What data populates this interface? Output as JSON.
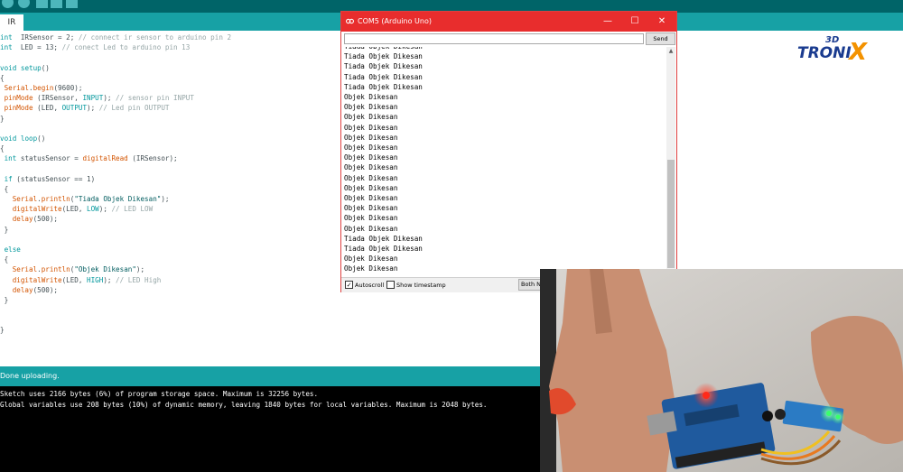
{
  "ide": {
    "tab_label": "IR",
    "code_lines": [
      [
        [
          "kw",
          "int"
        ],
        [
          "",
          "  IRSensor = 2; "
        ],
        [
          "cm",
          "// connect ir sensor to arduino pin 2"
        ]
      ],
      [
        [
          "kw",
          "int"
        ],
        [
          "",
          "  LED = 13; "
        ],
        [
          "cm",
          "// conect Led to arduino pin 13"
        ]
      ],
      [],
      [
        [
          "kw",
          "void"
        ],
        [
          "",
          " "
        ],
        [
          "kw",
          "setup"
        ],
        [
          "",
          "()"
        ]
      ],
      [
        [
          "",
          "{"
        ]
      ],
      [
        [
          "",
          " "
        ],
        [
          "fn",
          "Serial"
        ],
        [
          "",
          "."
        ],
        [
          "fn",
          "begin"
        ],
        [
          "",
          "(9600);"
        ]
      ],
      [
        [
          "",
          " "
        ],
        [
          "fn",
          "pinMode"
        ],
        [
          "",
          " (IRSensor, "
        ],
        [
          "kw",
          "INPUT"
        ],
        [
          "",
          "); "
        ],
        [
          "cm",
          "// sensor pin INPUT"
        ]
      ],
      [
        [
          "",
          " "
        ],
        [
          "fn",
          "pinMode"
        ],
        [
          "",
          " (LED, "
        ],
        [
          "kw",
          "OUTPUT"
        ],
        [
          "",
          "); "
        ],
        [
          "cm",
          "// Led pin OUTPUT"
        ]
      ],
      [
        [
          "",
          "}"
        ]
      ],
      [],
      [
        [
          "kw",
          "void"
        ],
        [
          "",
          " "
        ],
        [
          "kw",
          "loop"
        ],
        [
          "",
          "()"
        ]
      ],
      [
        [
          "",
          "{"
        ]
      ],
      [
        [
          "",
          " "
        ],
        [
          "kw",
          "int"
        ],
        [
          "",
          " statusSensor = "
        ],
        [
          "fn",
          "digitalRead"
        ],
        [
          "",
          " (IRSensor);"
        ]
      ],
      [],
      [
        [
          "",
          " "
        ],
        [
          "kw",
          "if"
        ],
        [
          "",
          " (statusSensor == 1)"
        ]
      ],
      [
        [
          "",
          " {"
        ]
      ],
      [
        [
          "",
          "   "
        ],
        [
          "fn",
          "Serial"
        ],
        [
          "",
          "."
        ],
        [
          "fn",
          "println"
        ],
        [
          "",
          "("
        ],
        [
          "str",
          "\"Tiada Objek Dikesan\""
        ],
        [
          "",
          ");"
        ]
      ],
      [
        [
          "",
          "   "
        ],
        [
          "fn",
          "digitalWrite"
        ],
        [
          "",
          "(LED, "
        ],
        [
          "kw",
          "LOW"
        ],
        [
          "",
          "); "
        ],
        [
          "cm",
          "// LED LOW"
        ]
      ],
      [
        [
          "",
          "   "
        ],
        [
          "fn",
          "delay"
        ],
        [
          "",
          "(500);"
        ]
      ],
      [
        [
          "",
          " }"
        ]
      ],
      [],
      [
        [
          "",
          " "
        ],
        [
          "kw",
          "else"
        ]
      ],
      [
        [
          "",
          " {"
        ]
      ],
      [
        [
          "",
          "   "
        ],
        [
          "fn",
          "Serial"
        ],
        [
          "",
          "."
        ],
        [
          "fn",
          "println"
        ],
        [
          "",
          "("
        ],
        [
          "str",
          "\"Objek Dikesan\""
        ],
        [
          "",
          ");"
        ]
      ],
      [
        [
          "",
          "   "
        ],
        [
          "fn",
          "digitalWrite"
        ],
        [
          "",
          "(LED, "
        ],
        [
          "kw",
          "HIGH"
        ],
        [
          "",
          "); "
        ],
        [
          "cm",
          "// LED High"
        ]
      ],
      [
        [
          "",
          "   "
        ],
        [
          "fn",
          "delay"
        ],
        [
          "",
          "(500);"
        ]
      ],
      [
        [
          "",
          " }"
        ]
      ],
      [],
      [],
      [
        [
          "",
          "}"
        ]
      ]
    ],
    "status": "Done uploading.",
    "console_lines": [
      "Sketch uses 2166 bytes (6%) of program storage space. Maximum is 32256 bytes.",
      "Global variables use 208 bytes (10%) of dynamic memory, leaving 1840 bytes for local variables. Maximum is 2048 bytes."
    ],
    "colors": {
      "toolbar": "#006468",
      "tabbar": "#17a1a5",
      "keyword": "#00979c",
      "function": "#d35400",
      "comment": "#95a5a6"
    }
  },
  "serial_monitor": {
    "title": "COM5 (Arduino Uno)",
    "minimize": "—",
    "maximize": "☐",
    "close": "✕",
    "input_value": "",
    "send_label": "Send",
    "output_lines": [
      "Tiada Objek Dikesan",
      "Tiada Objek Dikesan",
      "Tiada Objek Dikesan",
      "Tiada Objek Dikesan",
      "Tiada Objek Dikesan",
      "Objek Dikesan",
      "Objek Dikesan",
      "Objek Dikesan",
      "Objek Dikesan",
      "Objek Dikesan",
      "Objek Dikesan",
      "Objek Dikesan",
      "Objek Dikesan",
      "Objek Dikesan",
      "Objek Dikesan",
      "Objek Dikesan",
      "Objek Dikesan",
      "Objek Dikesan",
      "Objek Dikesan",
      "Tiada Objek Dikesan",
      "Tiada Objek Dikesan",
      "Objek Dikesan",
      "Objek Dikesan"
    ],
    "autoscroll_label": "Autoscroll",
    "autoscroll_checked": true,
    "timestamp_label": "Show timestamp",
    "timestamp_checked": false,
    "line_ending": "Both NL",
    "title_color": "#e82d2d"
  },
  "logo": {
    "text_main": "TRONI",
    "text_super": "3D",
    "text_x": "X",
    "colors": {
      "blue": "#1a3b8f",
      "orange": "#f39200"
    }
  },
  "photo": {
    "led_color": "#ff2a1a",
    "sensor_led_color": "#39ff6a"
  }
}
